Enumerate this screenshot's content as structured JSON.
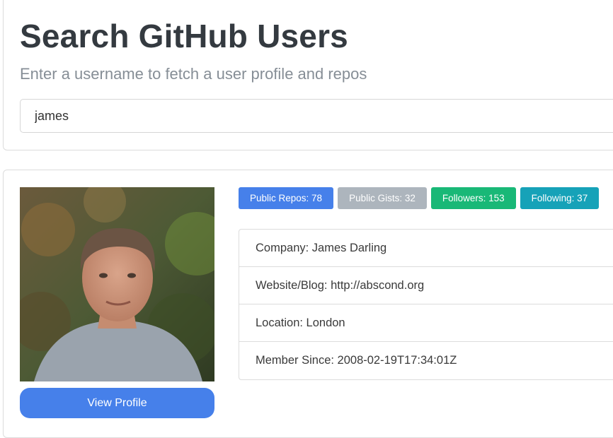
{
  "search": {
    "title": "Search GitHub Users",
    "subtitle": "Enter a username to fetch a user profile and repos",
    "input_value": "james"
  },
  "profile": {
    "view_profile_label": "View Profile",
    "badges": [
      {
        "label": "Public Repos: 78",
        "color": "#4680ea"
      },
      {
        "label": "Public Gists: 32",
        "color": "#adb5bd"
      },
      {
        "label": "Followers: 153",
        "color": "#19b877"
      },
      {
        "label": "Following: 37",
        "color": "#16a2b8"
      }
    ],
    "details": [
      "Company: James Darling",
      "Website/Blog: http://abscond.org",
      "Location: London",
      "Member Since: 2008-02-19T17:34:01Z"
    ]
  }
}
